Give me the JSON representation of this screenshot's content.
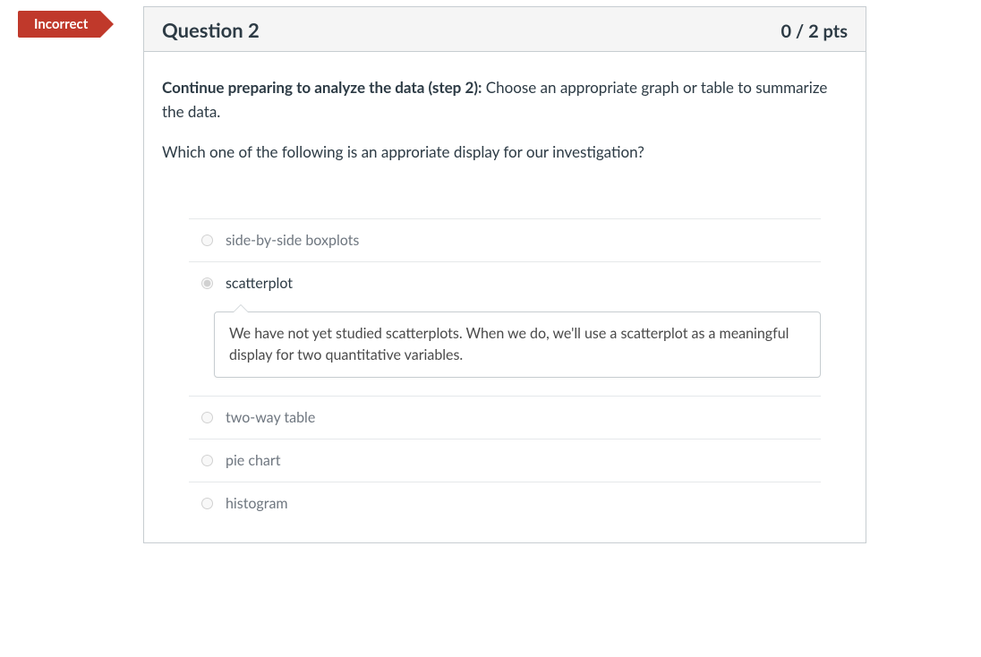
{
  "badge": {
    "label": "Incorrect"
  },
  "header": {
    "title": "Question 2",
    "points": "0 / 2 pts"
  },
  "prompt": {
    "lead": "Continue preparing to analyze the data (step 2):",
    "rest": " Choose an appropriate graph or table to summarize the data.",
    "line2": "Which one of the following is an approriate display for our investigation?"
  },
  "answers": [
    {
      "label": "side-by-side boxplots",
      "selected": false
    },
    {
      "label": "scatterplot",
      "selected": true,
      "feedback": "We have not yet studied scatterplots. When we do, we'll use a scatterplot as a meaningful display for two quantitative variables."
    },
    {
      "label": "two-way table",
      "selected": false
    },
    {
      "label": "pie chart",
      "selected": false
    },
    {
      "label": "histogram",
      "selected": false
    }
  ]
}
